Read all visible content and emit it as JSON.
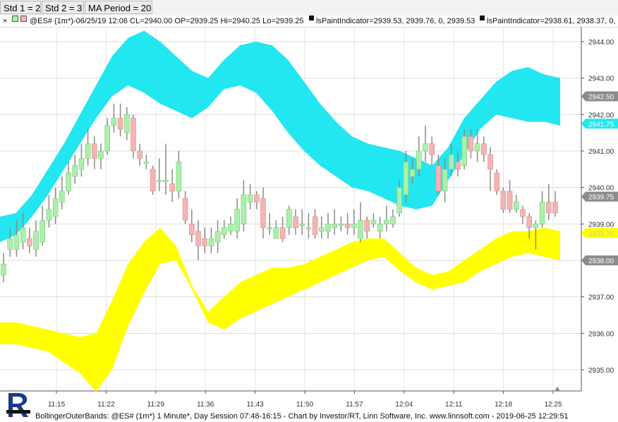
{
  "params": {
    "std1": "Std 1 = 2",
    "std2": "Std 2 = 3",
    "ma_period": "MA Period = 20"
  },
  "info": {
    "close_glyph": "×",
    "symbol_text": "@ES# (1m*)-06/25/19 12:06 CL=2940.00 OP=2939.25 Hi=2940.25 Lo=2939.25",
    "indicator1": "lsPaintIndicator=2939.53, 2939.76, 0, 2939.53",
    "indicator2": "lsPaintIndicator=2938.61, 2938.37, 0,"
  },
  "footer": "BollingerOuterBands: @ES# (1m*) 1 Minute*, Day Session 07:48-16:15 - Chart by Investor/RT, Linn Software, Inc. www.linnsoft.com - 2019-06-25 12:29:51",
  "colors": {
    "upper_band": "#22e6f0",
    "lower_band": "#ffff00",
    "up_candle": "#aaf0aa",
    "down_candle": "#f4b4b4",
    "wick": "#8a8a8a"
  },
  "chart_data": {
    "type": "candlestick",
    "y_ticks": [
      "2944.00",
      "2943.00",
      "2942.00",
      "2941.00",
      "2940.00",
      "2939.00",
      "2938.00",
      "2937.00",
      "2936.00",
      "2935.00"
    ],
    "x_ticks": [
      "11:15",
      "11:22",
      "11:29",
      "11:36",
      "11:43",
      "11:50",
      "11:57",
      "12:04",
      "12:11",
      "12:18",
      "12:25"
    ],
    "price_labels": [
      {
        "text": "2942.50",
        "value": 2942.5,
        "style": "gray"
      },
      {
        "text": "2941.75",
        "value": 2941.75,
        "style": "cyan"
      },
      {
        "text": "2939.75",
        "value": 2939.75,
        "style": "gray"
      },
      {
        "text": "2938.75",
        "value": 2938.75,
        "style": "yellow"
      },
      {
        "text": "2938.00",
        "value": 2938.0,
        "style": "gray"
      }
    ],
    "upper_band": {
      "outer": [
        2939.2,
        2939.3,
        2939.8,
        2940.5,
        2941.2,
        2942.0,
        2942.8,
        2943.6,
        2944.1,
        2944.3,
        2944.0,
        2943.6,
        2943.2,
        2943.0,
        2943.5,
        2943.9,
        2944.0,
        2943.9,
        2943.5,
        2942.9,
        2942.3,
        2941.8,
        2941.4,
        2941.2,
        2941.1,
        2941.0,
        2940.8,
        2940.6,
        2941.1,
        2941.9,
        2942.4,
        2942.9,
        2943.2,
        2943.3,
        2943.1,
        2943.0
      ],
      "inner": [
        2938.5,
        2938.7,
        2939.2,
        2939.8,
        2940.5,
        2941.2,
        2941.9,
        2942.5,
        2942.8,
        2942.6,
        2942.3,
        2942.1,
        2941.9,
        2942.2,
        2942.7,
        2942.8,
        2942.6,
        2942.1,
        2941.5,
        2941.0,
        2940.6,
        2940.3,
        2940.0,
        2939.9,
        2939.7,
        2939.5,
        2939.4,
        2939.5,
        2940.2,
        2940.9,
        2941.6,
        2942.0,
        2941.9,
        2941.8,
        2941.8,
        2941.7
      ]
    },
    "lower_band": {
      "inner": [
        2936.3,
        2936.3,
        2936.2,
        2936.1,
        2936.0,
        2935.9,
        2936.0,
        2936.9,
        2937.9,
        2938.5,
        2938.9,
        2938.4,
        2937.3,
        2936.6,
        2937.0,
        2937.4,
        2937.6,
        2937.8,
        2937.8,
        2937.9,
        2938.1,
        2938.3,
        2938.5,
        2938.6,
        2938.6,
        2938.2,
        2937.8,
        2937.6,
        2937.7,
        2938.0,
        2938.3,
        2938.6,
        2938.8,
        2938.8,
        2938.9,
        2938.8
      ],
      "outer": [
        2935.7,
        2935.7,
        2935.6,
        2935.5,
        2935.2,
        2934.9,
        2934.4,
        2935.0,
        2936.2,
        2937.1,
        2937.9,
        2938.0,
        2937.2,
        2936.3,
        2936.1,
        2936.4,
        2936.6,
        2936.8,
        2937.0,
        2937.2,
        2937.4,
        2937.6,
        2937.8,
        2938.0,
        2938.1,
        2937.7,
        2937.4,
        2937.2,
        2937.3,
        2937.4,
        2937.7,
        2937.9,
        2938.1,
        2938.2,
        2938.1,
        2938.0
      ]
    },
    "candles": [
      {
        "o": 2937.6,
        "c": 2937.9,
        "h": 2938.2,
        "l": 2937.4
      },
      {
        "o": 2938.3,
        "c": 2938.6,
        "h": 2938.9,
        "l": 2938.1
      },
      {
        "o": 2938.3,
        "c": 2938.7,
        "h": 2939.1,
        "l": 2938.1
      },
      {
        "o": 2938.5,
        "c": 2938.9,
        "h": 2939.3,
        "l": 2938.3
      },
      {
        "o": 2938.6,
        "c": 2938.4,
        "h": 2938.9,
        "l": 2938.2
      },
      {
        "o": 2938.3,
        "c": 2938.8,
        "h": 2939.1,
        "l": 2938.1
      },
      {
        "o": 2938.5,
        "c": 2939.1,
        "h": 2939.5,
        "l": 2938.4
      },
      {
        "o": 2939.1,
        "c": 2939.4,
        "h": 2939.8,
        "l": 2938.9
      },
      {
        "o": 2939.2,
        "c": 2939.7,
        "h": 2940.0,
        "l": 2939.0
      },
      {
        "o": 2939.6,
        "c": 2939.9,
        "h": 2940.3,
        "l": 2939.4
      },
      {
        "o": 2939.9,
        "c": 2940.4,
        "h": 2940.7,
        "l": 2939.8
      },
      {
        "o": 2940.3,
        "c": 2940.6,
        "h": 2940.9,
        "l": 2940.1
      },
      {
        "o": 2940.5,
        "c": 2940.8,
        "h": 2941.2,
        "l": 2940.3
      },
      {
        "o": 2940.8,
        "c": 2941.2,
        "h": 2941.6,
        "l": 2940.6
      },
      {
        "o": 2941.2,
        "c": 2940.8,
        "h": 2941.4,
        "l": 2940.5
      },
      {
        "o": 2940.8,
        "c": 2941.0,
        "h": 2941.2,
        "l": 2940.5
      },
      {
        "o": 2941.0,
        "c": 2941.7,
        "h": 2941.9,
        "l": 2940.9
      },
      {
        "o": 2941.7,
        "c": 2941.9,
        "h": 2942.3,
        "l": 2941.5
      },
      {
        "o": 2941.9,
        "c": 2941.6,
        "h": 2942.3,
        "l": 2941.4
      },
      {
        "o": 2941.5,
        "c": 2942.0,
        "h": 2942.2,
        "l": 2941.3
      },
      {
        "o": 2941.9,
        "c": 2941.0,
        "h": 2942.0,
        "l": 2940.8
      },
      {
        "o": 2941.0,
        "c": 2940.8,
        "h": 2941.2,
        "l": 2940.6
      },
      {
        "o": 2940.7,
        "c": 2940.7,
        "h": 2940.9,
        "l": 2940.5
      },
      {
        "o": 2940.5,
        "c": 2939.9,
        "h": 2940.6,
        "l": 2939.8
      },
      {
        "o": 2940.2,
        "c": 2940.2,
        "h": 2940.8,
        "l": 2939.9
      },
      {
        "o": 2940.2,
        "c": 2940.2,
        "h": 2941.2,
        "l": 2939.8
      },
      {
        "o": 2940.1,
        "c": 2939.9,
        "h": 2940.5,
        "l": 2939.6
      },
      {
        "o": 2939.9,
        "c": 2940.7,
        "h": 2941.0,
        "l": 2939.7
      },
      {
        "o": 2939.7,
        "c": 2939.1,
        "h": 2939.9,
        "l": 2939.0
      },
      {
        "o": 2939.0,
        "c": 2938.7,
        "h": 2939.4,
        "l": 2938.5
      },
      {
        "o": 2938.8,
        "c": 2938.4,
        "h": 2939.1,
        "l": 2938.0
      },
      {
        "o": 2938.6,
        "c": 2938.4,
        "h": 2938.9,
        "l": 2938.2
      },
      {
        "o": 2938.4,
        "c": 2938.6,
        "h": 2938.9,
        "l": 2938.2
      },
      {
        "o": 2938.5,
        "c": 2938.8,
        "h": 2939.1,
        "l": 2938.2
      },
      {
        "o": 2938.7,
        "c": 2938.9,
        "h": 2939.1,
        "l": 2938.6
      },
      {
        "o": 2938.8,
        "c": 2939.0,
        "h": 2939.2,
        "l": 2938.7
      },
      {
        "o": 2938.8,
        "c": 2939.4,
        "h": 2939.7,
        "l": 2938.6
      },
      {
        "o": 2939.0,
        "c": 2939.8,
        "h": 2940.2,
        "l": 2938.8
      },
      {
        "o": 2939.6,
        "c": 2939.8,
        "h": 2940.1,
        "l": 2939.4
      },
      {
        "o": 2939.8,
        "c": 2939.6,
        "h": 2939.9,
        "l": 2939.4
      },
      {
        "o": 2939.7,
        "c": 2938.9,
        "h": 2940.0,
        "l": 2938.6
      },
      {
        "o": 2938.9,
        "c": 2938.9,
        "h": 2939.3,
        "l": 2938.7
      },
      {
        "o": 2938.6,
        "c": 2938.9,
        "h": 2939.1,
        "l": 2938.6
      },
      {
        "o": 2938.9,
        "c": 2938.6,
        "h": 2939.2,
        "l": 2938.5
      },
      {
        "o": 2938.9,
        "c": 2939.4,
        "h": 2939.5,
        "l": 2938.7
      },
      {
        "o": 2939.2,
        "c": 2938.9,
        "h": 2939.4,
        "l": 2938.7
      },
      {
        "o": 2939.0,
        "c": 2939.0,
        "h": 2939.4,
        "l": 2938.7
      },
      {
        "o": 2938.9,
        "c": 2938.9,
        "h": 2939.3,
        "l": 2938.6
      },
      {
        "o": 2939.2,
        "c": 2938.7,
        "h": 2939.4,
        "l": 2938.6
      },
      {
        "o": 2938.8,
        "c": 2938.9,
        "h": 2939.2,
        "l": 2938.6
      },
      {
        "o": 2938.8,
        "c": 2939.0,
        "h": 2939.3,
        "l": 2938.6
      },
      {
        "o": 2938.9,
        "c": 2939.0,
        "h": 2939.4,
        "l": 2938.7
      },
      {
        "o": 2939.0,
        "c": 2939.0,
        "h": 2939.2,
        "l": 2938.8
      },
      {
        "o": 2939.0,
        "c": 2938.9,
        "h": 2939.3,
        "l": 2938.7
      },
      {
        "o": 2938.9,
        "c": 2939.0,
        "h": 2939.4,
        "l": 2938.7
      },
      {
        "o": 2938.6,
        "c": 2939.1,
        "h": 2939.6,
        "l": 2938.5
      },
      {
        "o": 2939.1,
        "c": 2938.8,
        "h": 2939.2,
        "l": 2938.6
      },
      {
        "o": 2939.0,
        "c": 2939.1,
        "h": 2939.3,
        "l": 2938.9
      },
      {
        "o": 2938.8,
        "c": 2939.0,
        "h": 2939.2,
        "l": 2938.6
      },
      {
        "o": 2939.0,
        "c": 2939.1,
        "h": 2939.5,
        "l": 2938.8
      },
      {
        "o": 2939.0,
        "c": 2939.2,
        "h": 2939.4,
        "l": 2938.9
      },
      {
        "o": 2939.3,
        "c": 2940.0,
        "h": 2940.2,
        "l": 2939.2
      },
      {
        "o": 2939.8,
        "c": 2940.7,
        "h": 2941.0,
        "l": 2939.6
      },
      {
        "o": 2940.3,
        "c": 2940.5,
        "h": 2940.8,
        "l": 2940.1
      },
      {
        "o": 2940.5,
        "c": 2941.0,
        "h": 2941.4,
        "l": 2940.3
      },
      {
        "o": 2941.0,
        "c": 2941.2,
        "h": 2941.7,
        "l": 2940.7
      },
      {
        "o": 2941.2,
        "c": 2940.9,
        "h": 2941.4,
        "l": 2940.6
      },
      {
        "o": 2940.6,
        "c": 2939.9,
        "h": 2940.9,
        "l": 2939.8
      },
      {
        "o": 2939.9,
        "c": 2940.5,
        "h": 2940.8,
        "l": 2939.6
      },
      {
        "o": 2940.5,
        "c": 2940.9,
        "h": 2941.2,
        "l": 2940.3
      },
      {
        "o": 2940.7,
        "c": 2940.5,
        "h": 2941.0,
        "l": 2940.3
      },
      {
        "o": 2940.6,
        "c": 2941.4,
        "h": 2941.6,
        "l": 2940.5
      },
      {
        "o": 2941.4,
        "c": 2941.0,
        "h": 2941.6,
        "l": 2940.8
      },
      {
        "o": 2941.0,
        "c": 2941.2,
        "h": 2941.6,
        "l": 2940.7
      },
      {
        "o": 2941.2,
        "c": 2940.9,
        "h": 2941.4,
        "l": 2940.7
      },
      {
        "o": 2940.9,
        "c": 2940.5,
        "h": 2941.1,
        "l": 2939.9
      },
      {
        "o": 2940.4,
        "c": 2939.9,
        "h": 2940.5,
        "l": 2939.8
      },
      {
        "o": 2939.9,
        "c": 2939.4,
        "h": 2940.0,
        "l": 2939.3
      },
      {
        "o": 2939.9,
        "c": 2939.4,
        "h": 2940.2,
        "l": 2939.3
      },
      {
        "o": 2939.4,
        "c": 2939.6,
        "h": 2939.8,
        "l": 2939.3
      },
      {
        "o": 2939.4,
        "c": 2939.2,
        "h": 2939.5,
        "l": 2939.0
      },
      {
        "o": 2939.2,
        "c": 2938.9,
        "h": 2939.3,
        "l": 2938.6
      },
      {
        "o": 2938.9,
        "c": 2939.0,
        "h": 2939.1,
        "l": 2938.3
      },
      {
        "o": 2939.0,
        "c": 2939.6,
        "h": 2939.9,
        "l": 2938.9
      },
      {
        "o": 2939.6,
        "c": 2939.3,
        "h": 2940.1,
        "l": 2939.1
      },
      {
        "o": 2939.6,
        "c": 2939.3,
        "h": 2939.9,
        "l": 2939.2
      }
    ]
  }
}
